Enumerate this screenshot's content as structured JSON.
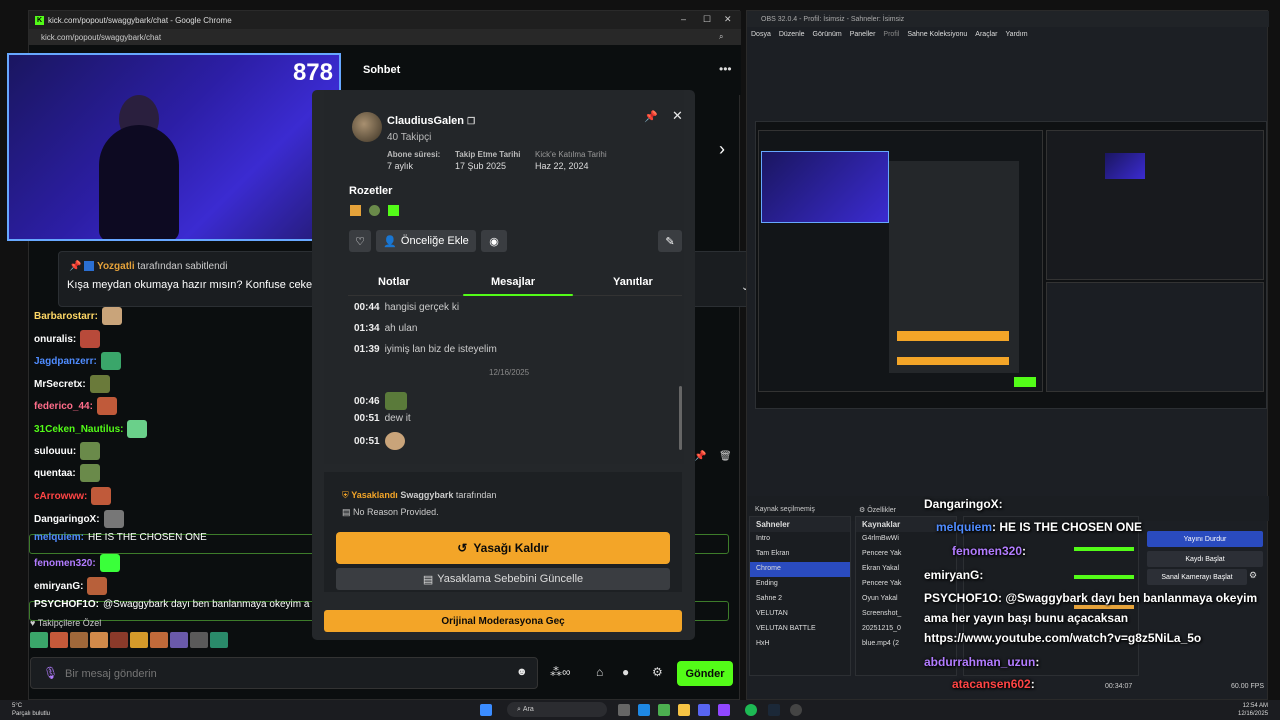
{
  "chrome": {
    "title": "kick.com/popout/swaggybark/chat - Google Chrome",
    "url": "kick.com/popout/swaggybark/chat"
  },
  "chat": {
    "title": "Sohbet",
    "viewer_count": "878",
    "pinned": {
      "by_user": "Yozgatli",
      "by_suffix": "tarafından sabitlendi",
      "message": "Kışa meydan okumaya hazır mısın? Konfuse ceketler ş"
    },
    "messages": [
      {
        "user": "Barbarostarr:",
        "color": "#ffd866"
      },
      {
        "user": "onuralis:",
        "color": "#ffffff"
      },
      {
        "user": "Jagdpanzerr:",
        "color": "#4f8cff"
      },
      {
        "user": "MrSecretx:",
        "color": "#ffffff"
      },
      {
        "user": "federico_44:",
        "color": "#ff6d8a"
      },
      {
        "user": "31Ceken_Nautilus:",
        "color": "#53fc18"
      },
      {
        "user": "sulouuu:",
        "color": "#ffffff"
      },
      {
        "user": "quentaa:",
        "color": "#ffffff"
      },
      {
        "user": "cArrowww:",
        "color": "#ff4545"
      },
      {
        "user": "DangaringoX:",
        "color": "#ffffff"
      },
      {
        "user": "melquiem:",
        "color": "#4f8cff",
        "text": "HE IS THE CHOSEN ONE"
      },
      {
        "user": "fenomen320:",
        "color": "#b27cff"
      },
      {
        "user": "emiryanG:",
        "color": "#ffffff"
      },
      {
        "user": "PSYCHOF1O:",
        "color": "#ffffff",
        "text": "@Swaggybark dayı ben banlanmaya okeyim a"
      }
    ],
    "followers_only": "Takipçilere Özel",
    "input_placeholder": "Bir mesaj gönderin",
    "send_label": "Gönder"
  },
  "user_card": {
    "name": "ClaudiusGalen",
    "followers": "40 Takipçi",
    "stats": [
      {
        "label": "Abone süresi:",
        "value": "7 aylık"
      },
      {
        "label": "Takip Etme Tarihi",
        "value": "17 Şub 2025"
      },
      {
        "label": "Kick'e Katılma Tarihi",
        "value": "Haz 22, 2024"
      }
    ],
    "badges_title": "Rozetler",
    "priority_label": "Önceliğe Ekle",
    "tabs": [
      "Notlar",
      "Mesajlar",
      "Yanıtlar"
    ],
    "history": [
      {
        "time": "00:44",
        "text": "hangisi gerçek ki"
      },
      {
        "time": "01:34",
        "text": "ah ulan"
      },
      {
        "time": "01:39",
        "text": "iyimiş lan biz de isteyelim"
      }
    ],
    "date_separator": "12/16/2025",
    "history2": [
      {
        "time": "00:46",
        "text": ""
      },
      {
        "time": "00:51",
        "text": "dew it"
      },
      {
        "time": "00:51",
        "text": ""
      }
    ],
    "ban_status": "Yasaklandı",
    "ban_by": "Swaggybark",
    "ban_by_suffix": "tarafından",
    "ban_reason": "No Reason Provided.",
    "unban_label": "Yasağı Kaldır",
    "update_reason_label": "Yasaklama Sebebini Güncelle",
    "orig_mod_label": "Orijinal Moderasyona Geç"
  },
  "obs": {
    "title": "OBS 32.0.4 - Profil: İsimsiz - Sahneler: İsimsiz",
    "menu": [
      "Dosya",
      "Düzenle",
      "Görünüm",
      "Paneller",
      "Profil",
      "Sahne Koleksiyonu",
      "Araçlar",
      "Yardım"
    ],
    "source_none": "Kaynak seçilmemiş",
    "properties": "Özellikler",
    "scenes_title": "Sahneler",
    "scenes": [
      "Intro",
      "Tam Ekran",
      "Chrome",
      "Ending",
      "Sahne 2",
      "VELUTAN",
      "VELUTAN BATTLE",
      "HxH"
    ],
    "selected_scene": "Chrome",
    "sources_title": "Kaynaklar",
    "sources": [
      "G4rlmBwWi",
      "Pencere Yak",
      "Ekran Yakal",
      "Pencere Yak",
      "Oyun Yakal",
      "Screenshot_",
      "20251215_0",
      "blue.mp4 (2"
    ],
    "stop_stream": "Yayını Durdur",
    "start_record": "Kaydı Başlat",
    "virtual_cam": "Sanal Kamerayı Başlat",
    "fps": "60.00 FPS",
    "time": "00:34:07"
  },
  "overlay": [
    {
      "user": "DangaringoX",
      "text": ":"
    },
    {
      "user": "melquiem",
      "text": ": HE IS THE CHOSEN ONE"
    },
    {
      "user": "fenomen320",
      "text": ":"
    },
    {
      "user": "emiryanG",
      "text": ":"
    },
    {
      "user": "PSYCHOF1O",
      "text": ": @Swaggybark dayı ben banlanmaya okeyim"
    },
    {
      "user": "",
      "text": "ama her yayın başı bunu açacaksan"
    },
    {
      "user": "",
      "text": "https://www.youtube.com/watch?v=g8z5NiLa_5o"
    },
    {
      "user": "abdurrahman_uzun",
      "text": ":"
    },
    {
      "user": "atacansen602",
      "text": ":"
    }
  ],
  "taskbar": {
    "weather_temp": "5°C",
    "weather_desc": "Parçalı bulutlu",
    "search": "Ara",
    "time": "12:54 AM",
    "date": "12/16/2025"
  },
  "colors": {
    "kick_green": "#53fc18",
    "ban_orange": "#f3a528",
    "obs_blue": "#2a4bbf"
  }
}
